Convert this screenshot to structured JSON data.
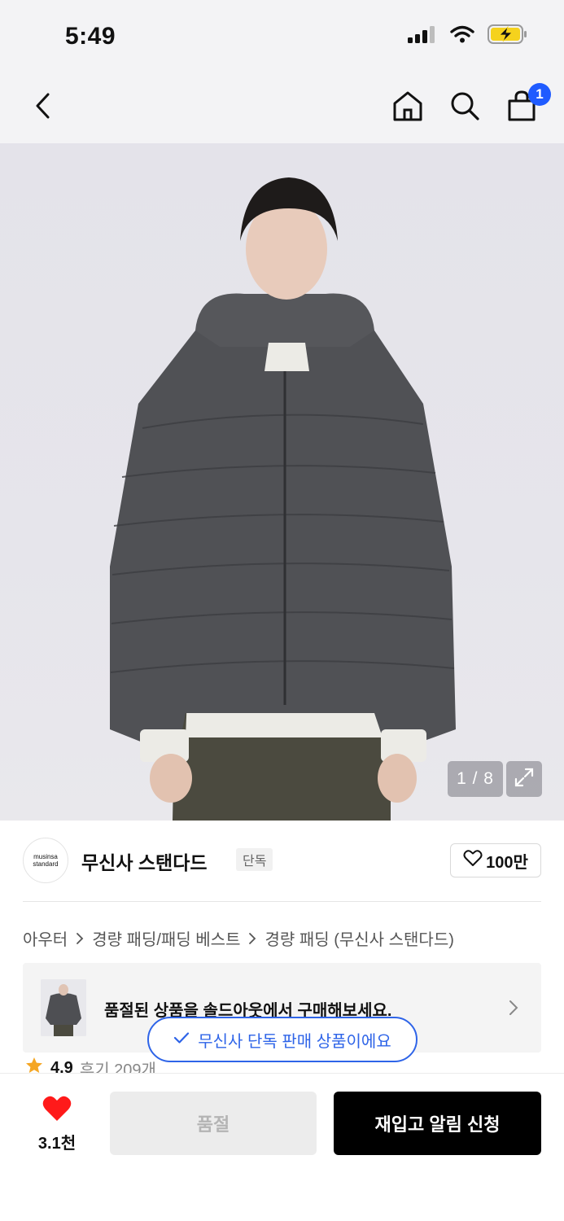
{
  "status_bar": {
    "time": "5:49",
    "icons": [
      "cellular-signal-icon",
      "wifi-icon",
      "battery-charging-icon"
    ]
  },
  "header": {
    "back_icon": "chevron-left-icon",
    "home_icon": "home-icon",
    "search_icon": "search-icon",
    "cart_icon": "shopping-bag-icon",
    "cart_badge": "1"
  },
  "product_image": {
    "counter": "1 / 8",
    "expand_icon": "expand-icon"
  },
  "brand": {
    "logo_line1": "musinsa",
    "logo_line2": "standard",
    "name": "무신사 스탠다드",
    "tag": "단독",
    "like_count": "100만"
  },
  "breadcrumb": [
    "아우터",
    "경량 패딩/패딩 베스트",
    "경량 패딩 (무신사 스탠다드)"
  ],
  "soldout_banner": {
    "text": "품절된 상품을 솔드아웃에서 구매해보세요."
  },
  "rating": {
    "score": "4.9",
    "reviews": "후기 209개"
  },
  "toast": {
    "text": "무신사 단독 판매 상품이에요"
  },
  "bottom_bar": {
    "wish_count": "3.1천",
    "soldout_label": "품절",
    "restock_label": "재입고 알림 신청"
  },
  "colors": {
    "accent_blue": "#2e64e8",
    "badge_blue": "#1f5bff",
    "heart_red": "#ff1a1a",
    "cta_black": "#000000"
  }
}
